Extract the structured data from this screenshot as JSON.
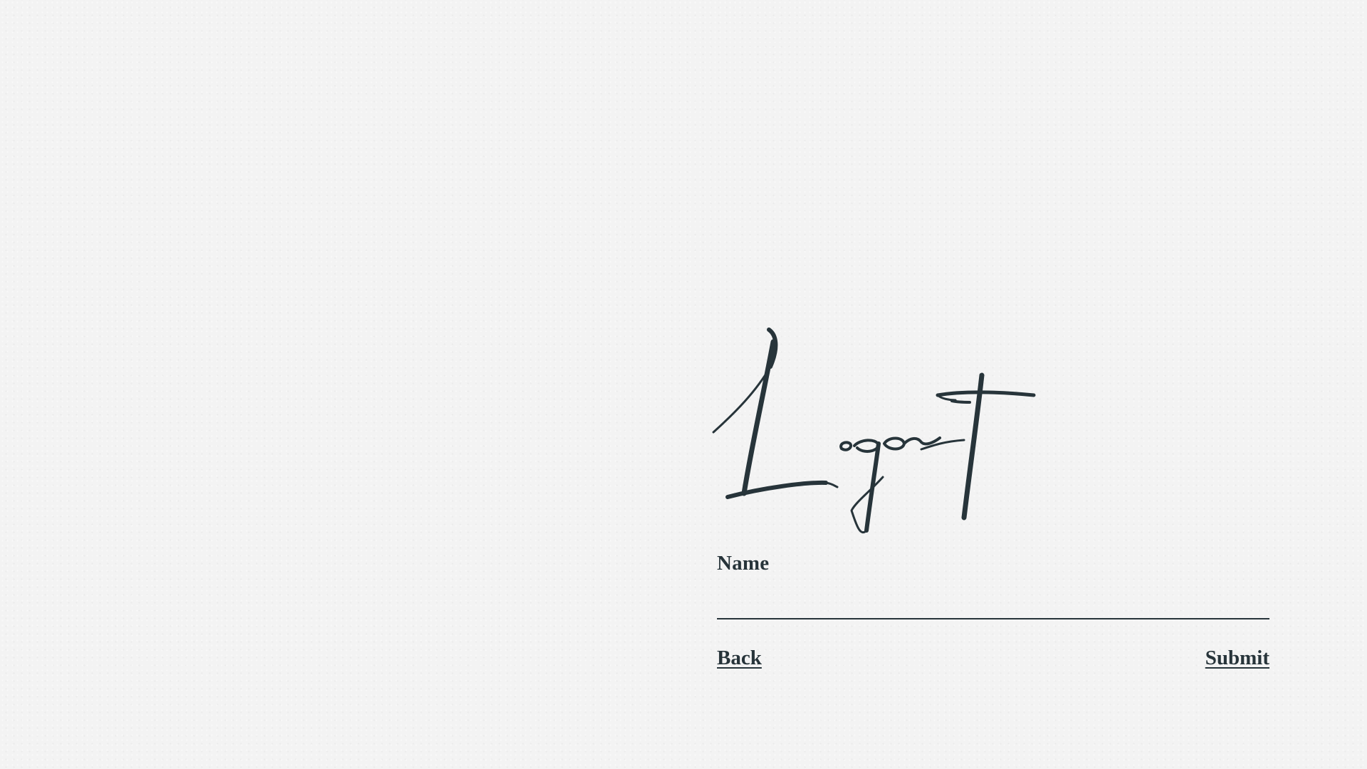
{
  "page": {
    "title": "Logout",
    "accent_color": "#27343a",
    "background_color": "#f3f3f3"
  },
  "form": {
    "name_label": "Name",
    "name_value": "",
    "name_placeholder": ""
  },
  "actions": {
    "back_label": "Back",
    "submit_label": "Submit"
  }
}
